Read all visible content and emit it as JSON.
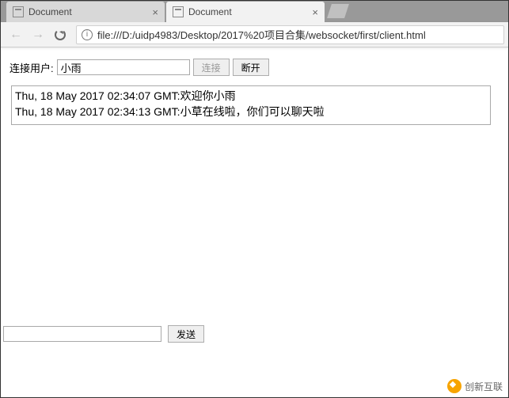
{
  "tabs": [
    {
      "title": "Document",
      "active": false
    },
    {
      "title": "Document",
      "active": true
    }
  ],
  "address": {
    "url": "file:///D:/uidp4983/Desktop/2017%20项目合集/websocket/first/client.html"
  },
  "connection": {
    "label": "连接用户:",
    "username": "小雨",
    "connect_label": "连接",
    "disconnect_label": "断开"
  },
  "log_lines": [
    "Thu, 18 May 2017 02:34:07 GMT:欢迎你小雨",
    "Thu, 18 May 2017 02:34:13 GMT:小草在线啦，你们可以聊天啦"
  ],
  "send": {
    "message": "",
    "send_label": "发送"
  },
  "watermark": "创新互联"
}
